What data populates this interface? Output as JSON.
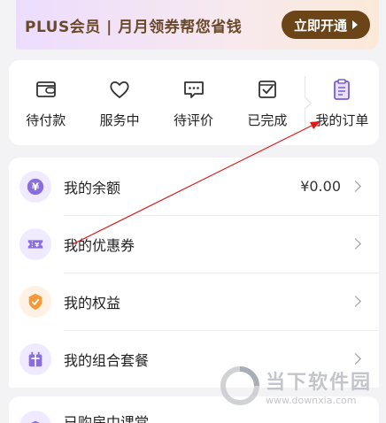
{
  "plus_banner": {
    "text": "PLUS会员 | 月月领券帮您省钱",
    "button_label": "立即开通"
  },
  "orders": [
    {
      "label": "待付款",
      "icon": "wallet-icon"
    },
    {
      "label": "服务中",
      "icon": "heart-icon"
    },
    {
      "label": "待评价",
      "icon": "comment-icon"
    },
    {
      "label": "已完成",
      "icon": "checked-box-icon"
    },
    {
      "label": "我的订单",
      "icon": "clipboard-icon"
    }
  ],
  "list": [
    {
      "label": "我的余额",
      "value": "¥0.00",
      "icon": "yen-icon"
    },
    {
      "label": "我的优惠券",
      "value": "",
      "icon": "coupon-icon"
    },
    {
      "label": "我的权益",
      "value": "",
      "icon": "badge-icon"
    },
    {
      "label": "我的组合套餐",
      "value": "",
      "icon": "gift-icon"
    }
  ],
  "bottom": {
    "label": "已购房中课堂",
    "icon": "graduation-cap-icon"
  },
  "watermark": {
    "title": "当下软件园",
    "url": "www.downxia.com"
  },
  "colors": {
    "accent": "#7b5bd6",
    "plus_button": "#6b4418",
    "annotation": "#e01818"
  }
}
